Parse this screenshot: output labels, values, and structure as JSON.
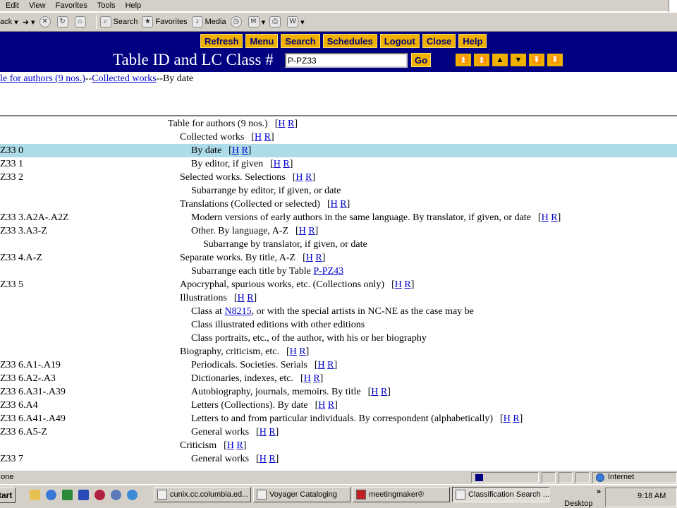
{
  "menubar": [
    "Edit",
    "View",
    "Favorites",
    "Tools",
    "Help"
  ],
  "toolbar": {
    "back": "ack",
    "search": "Search",
    "favorites": "Favorites",
    "media": "Media"
  },
  "nav": {
    "buttons": [
      "Refresh",
      "Menu",
      "Search",
      "Schedules",
      "Logout",
      "Close",
      "Help"
    ],
    "title": "Table ID and LC Class #",
    "input_value": "P-PZ33",
    "go": "Go",
    "accent": "#f0b000",
    "band_color": "#000080"
  },
  "breadcrumb": {
    "link1": "le for authors (9 nos.)",
    "sep1": "--",
    "link2": "Collected works",
    "tail": "--By date"
  },
  "hr": {
    "h": "H",
    "r": "R"
  },
  "rows": [
    {
      "code": "",
      "caption": "Table for authors (9 nos.)",
      "indent": 0,
      "hr": true
    },
    {
      "code": "",
      "caption": "Collected works",
      "indent": 1,
      "hr": true
    },
    {
      "code": "Z33 0",
      "caption": "By date",
      "indent": 2,
      "hr": true,
      "hl": true
    },
    {
      "code": "Z33 1",
      "caption": "By editor, if given",
      "indent": 2,
      "hr": true
    },
    {
      "code": "Z33 2",
      "caption": "Selected works. Selections",
      "indent": 1,
      "hr": true
    },
    {
      "code": "",
      "caption": "Subarrange by editor, if given, or date",
      "indent": 2,
      "hr": false
    },
    {
      "code": "",
      "caption": "Translations (Collected or selected)",
      "indent": 1,
      "hr": true
    },
    {
      "code": "Z33 3.A2A-.A2Z",
      "caption": "Modern versions of early authors in the same language. By translator, if given, or date",
      "indent": 2,
      "hr": true
    },
    {
      "code": "Z33 3.A3-Z",
      "caption": "Other. By language, A-Z",
      "indent": 2,
      "hr": true
    },
    {
      "code": "",
      "caption": "Subarrange by translator, if given, or date",
      "indent": 3,
      "hr": false
    },
    {
      "code": "Z33 4.A-Z",
      "caption": "Separate works. By title, A-Z",
      "indent": 1,
      "hr": true
    },
    {
      "code": "",
      "caption": "Subarrange each title by Table ",
      "link": "P-PZ43",
      "indent": 2,
      "hr": false
    },
    {
      "code": "Z33 5",
      "caption": "Apocryphal, spurious works, etc. (Collections only)",
      "indent": 1,
      "hr": true
    },
    {
      "code": "",
      "caption": "Illustrations",
      "indent": 1,
      "hr": true
    },
    {
      "code": "",
      "caption": "Class at ",
      "link": "N8215",
      "after": ", or with the special artists in NC-NE as the case may be",
      "indent": 2,
      "hr": false
    },
    {
      "code": "",
      "caption": "Class illustrated editions with other editions",
      "indent": 2,
      "hr": false
    },
    {
      "code": "",
      "caption": "Class portraits, etc., of the author, with his or her biography",
      "indent": 2,
      "hr": false
    },
    {
      "code": "",
      "caption": "Biography, criticism, etc.",
      "indent": 1,
      "hr": true
    },
    {
      "code": "Z33 6.A1-.A19",
      "caption": "Periodicals. Societies. Serials",
      "indent": 2,
      "hr": true
    },
    {
      "code": "Z33 6.A2-.A3",
      "caption": "Dictionaries, indexes, etc.",
      "indent": 2,
      "hr": true
    },
    {
      "code": "Z33 6.A31-.A39",
      "caption": "Autobiography, journals, memoirs. By title",
      "indent": 2,
      "hr": true
    },
    {
      "code": "Z33 6.A4",
      "caption": "Letters (Collections). By date",
      "indent": 2,
      "hr": true
    },
    {
      "code": "Z33 6.A41-.A49",
      "caption": "Letters to and from particular individuals. By correspondent (alphabetically)",
      "indent": 2,
      "hr": true
    },
    {
      "code": "Z33 6.A5-Z",
      "caption": "General works",
      "indent": 2,
      "hr": true
    },
    {
      "code": "",
      "caption": "Criticism",
      "indent": 1,
      "hr": true
    },
    {
      "code": "Z33 7",
      "caption": "General works",
      "indent": 2,
      "hr": true
    }
  ],
  "status": {
    "text": "one",
    "zone": "Internet"
  },
  "taskbar": {
    "start": "tart",
    "tasks": [
      "cunix.cc.columbia.ed...",
      "Voyager Cataloging",
      "meetingmaker®",
      "Classification Search ..."
    ],
    "desktop": "Desktop",
    "more": "»",
    "clock": "9:18 AM"
  }
}
